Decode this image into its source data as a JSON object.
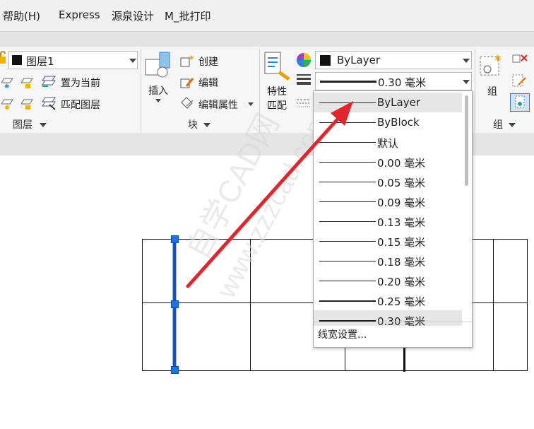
{
  "menu": {
    "items": [
      "帮助(H)",
      "Express",
      "源泉设计",
      "M_批打印"
    ]
  },
  "layer_panel": {
    "layer_combo_value": "图层1",
    "set_current_label": "置为当前",
    "match_layer_label": "匹配图层",
    "title": "图层"
  },
  "block_panel": {
    "insert_label": "插入",
    "create_label": "创建",
    "edit_label": "编辑",
    "edit_attr_label": "编辑属性",
    "title": "块"
  },
  "properties_panel": {
    "match_props_label_1": "特性",
    "match_props_label_2": "匹配",
    "color_combo_value": "ByLayer",
    "lineweight_combo_value": "0.30 毫米"
  },
  "group_panel": {
    "group_label": "组",
    "title": "组"
  },
  "lineweight_dropdown": {
    "options": [
      "ByLayer",
      "ByBlock",
      "默认",
      "0.00 毫米",
      "0.05 毫米",
      "0.09 毫米",
      "0.13 毫米",
      "0.15 毫米",
      "0.18 毫米",
      "0.20 毫米",
      "0.25 毫米",
      "0.30 毫米"
    ],
    "selected_index": 0,
    "current_index": 11,
    "footer_label": "线宽设置..."
  },
  "watermark": {
    "line1": "自学CAD网",
    "line2": "www.zzzcad.com"
  },
  "colors": {
    "accent": "#1a73e8",
    "arrow": "#e0262c"
  }
}
